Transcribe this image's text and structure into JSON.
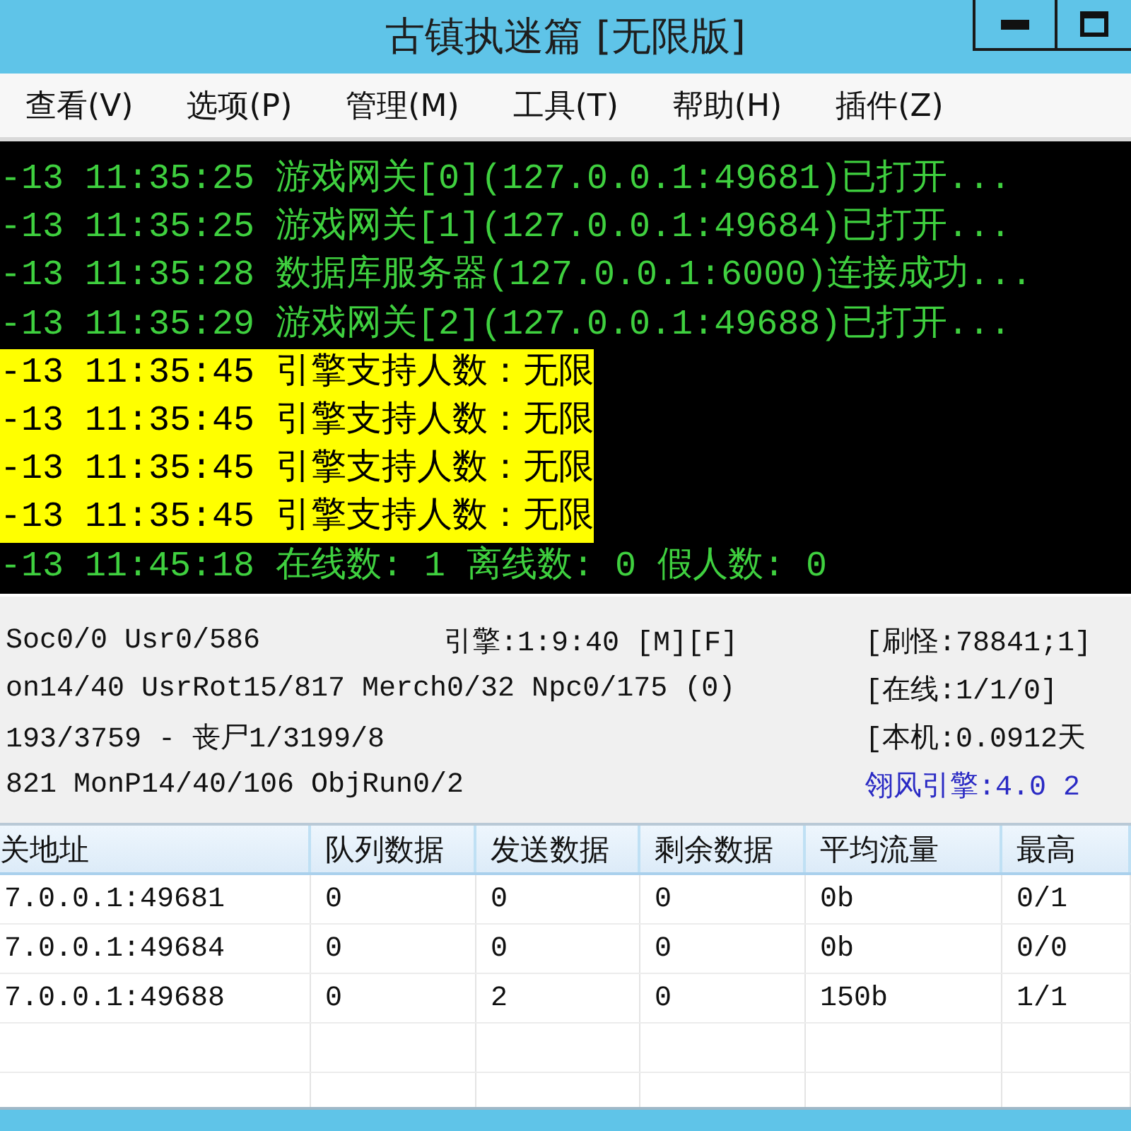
{
  "window": {
    "title": "古镇执迷篇 [无限版]",
    "controls": [
      {
        "kind": "minimize"
      },
      {
        "kind": "maximize"
      }
    ]
  },
  "menu": [
    {
      "label": "查看(V)"
    },
    {
      "label": "选项(P)"
    },
    {
      "label": "管理(M)"
    },
    {
      "label": "工具(T)"
    },
    {
      "label": "帮助(H)"
    },
    {
      "label": "插件(Z)"
    }
  ],
  "log": [
    {
      "kind": "info",
      "text": "-13 11:35:25 游戏网关[0](127.0.0.1:49681)已打开..."
    },
    {
      "kind": "info",
      "text": "-13 11:35:25 游戏网关[1](127.0.0.1:49684)已打开..."
    },
    {
      "kind": "info",
      "text": "-13 11:35:28 数据库服务器(127.0.0.1:6000)连接成功..."
    },
    {
      "kind": "info",
      "text": "-13 11:35:29 游戏网关[2](127.0.0.1:49688)已打开..."
    },
    {
      "kind": "highlight",
      "text": "-13 11:35:45 引擎支持人数：无限"
    },
    {
      "kind": "highlight",
      "text": "-13 11:35:45 引擎支持人数：无限"
    },
    {
      "kind": "highlight",
      "text": "-13 11:35:45 引擎支持人数：无限"
    },
    {
      "kind": "highlight",
      "text": "-13 11:35:45 引擎支持人数：无限"
    },
    {
      "kind": "info",
      "text": "-13 11:45:18 在线数: 1 离线数: 0 假人数: 0"
    }
  ],
  "status": {
    "rows": [
      {
        "left": "Soc0/0 Usr0/586",
        "engine_time": "引擎:1:9:40 [M][F]",
        "right": {
          "kind": "plain",
          "text": "[刷怪:78841;1]"
        }
      },
      {
        "left": "on14/40 UsrRot15/817 Merch0/32 Npc0/175 (0)",
        "right": {
          "kind": "plain",
          "text": "[在线:1/1/0]"
        }
      },
      {
        "left": "193/3759 - 丧尸1/3199/8",
        "right": {
          "kind": "plain",
          "text": "[本机:0.0912天"
        }
      },
      {
        "left": "821 MonP14/40/106 ObjRun0/2",
        "right": {
          "kind": "version",
          "text": "翎风引擎:4.0 2"
        }
      }
    ]
  },
  "table": {
    "columns": [
      "关地址",
      "队列数据",
      "发送数据",
      "剩余数据",
      "平均流量",
      "最高"
    ],
    "rows": [
      [
        "7.0.0.1:49681",
        "0",
        "0",
        "0",
        "0b",
        "0/1"
      ],
      [
        "7.0.0.1:49684",
        "0",
        "0",
        "0",
        "0b",
        "0/0"
      ],
      [
        "7.0.0.1:49688",
        "0",
        "2",
        "0",
        "150b",
        "1/1"
      ]
    ]
  }
}
